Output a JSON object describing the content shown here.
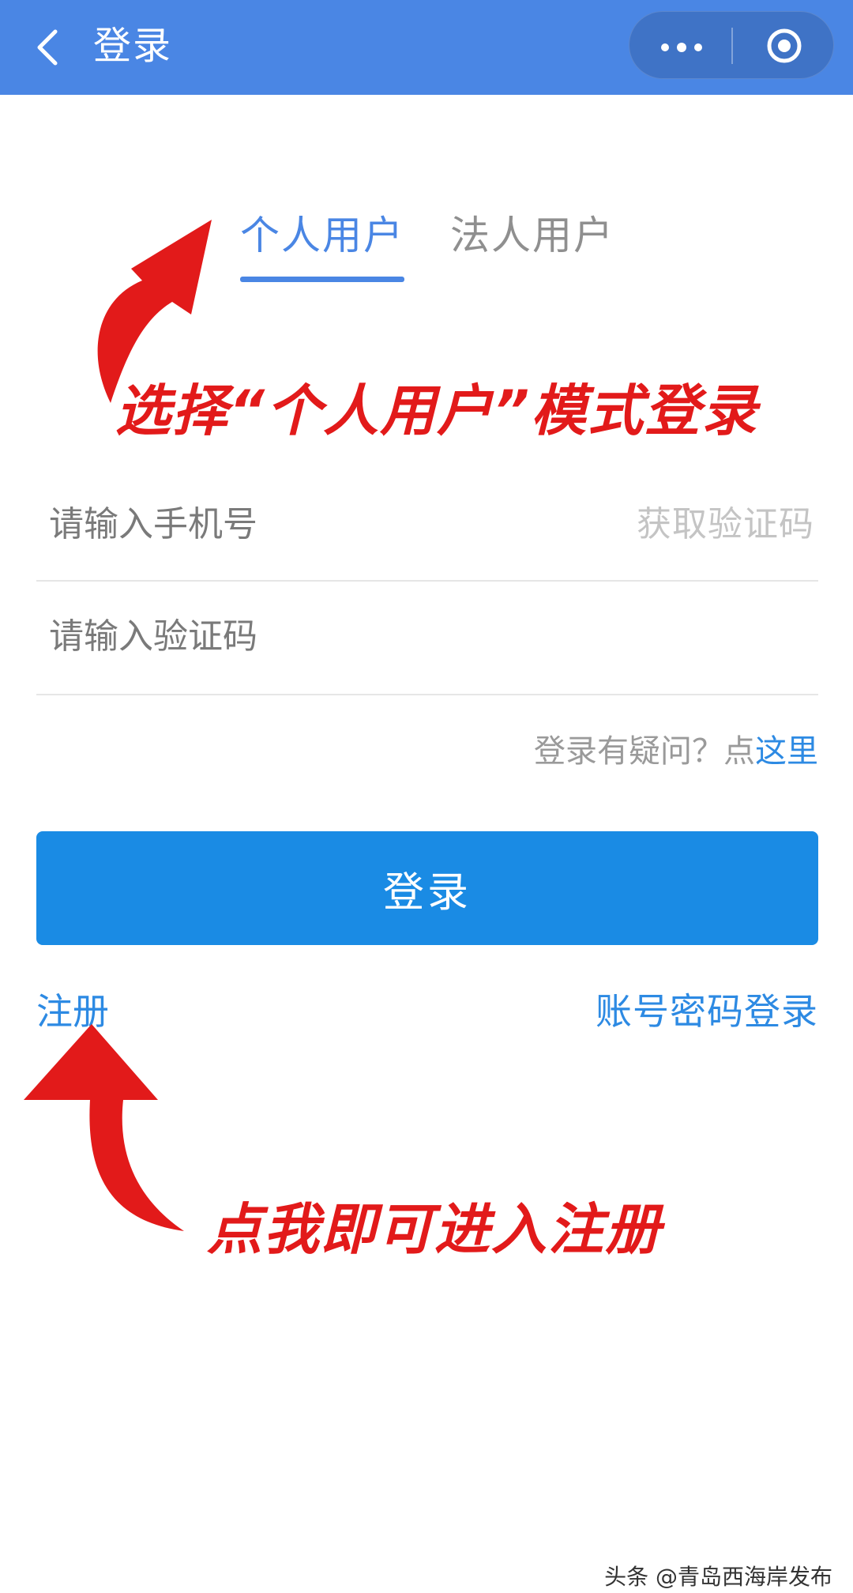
{
  "header": {
    "title": "登录",
    "back_icon": "chevron-left-icon",
    "more_icon": "more-dots-icon",
    "close_icon": "target-circle-icon",
    "bg_color": "#4a86e4"
  },
  "tabs": [
    {
      "label": "个人用户",
      "active": true
    },
    {
      "label": "法人用户",
      "active": false
    }
  ],
  "annotations": {
    "select_mode": "选择“个人用户”模式登录",
    "register_hint": "点我即可进入注册",
    "color": "#e21a1a"
  },
  "form": {
    "phone_placeholder": "请输入手机号",
    "get_code_label": "获取验证码",
    "code_placeholder": "请输入验证码"
  },
  "help": {
    "text": "登录有疑问？点",
    "link": "这里"
  },
  "login_button": "登录",
  "register_link": "注册",
  "password_login_link": "账号密码登录",
  "watermark": "头条 @青岛西海岸发布",
  "accent_color": "#1a8be4"
}
